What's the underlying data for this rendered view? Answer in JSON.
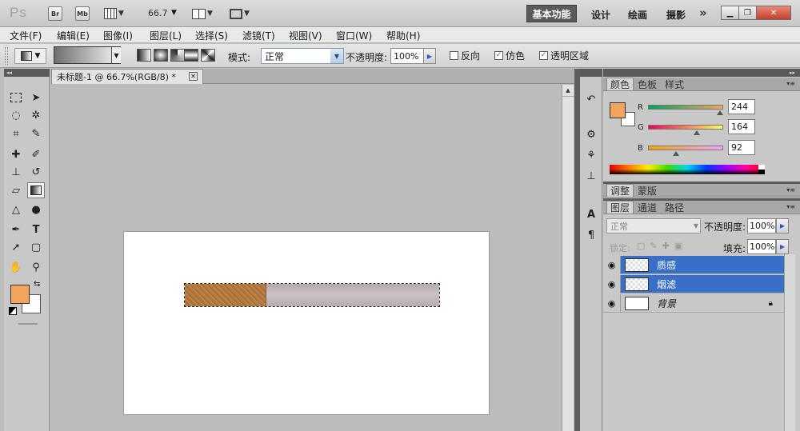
{
  "app": {
    "logo": "Ps"
  },
  "titlebar": {
    "br_label": "Br",
    "mb_label": "Mb",
    "zoom": "66.7",
    "workspaces": {
      "active": "基本功能",
      "design": "设计",
      "painting": "绘画",
      "photography": "摄影"
    },
    "more": "»"
  },
  "menu": {
    "file": "文件(F)",
    "edit": "编辑(E)",
    "image": "图像(I)",
    "layer": "图层(L)",
    "select": "选择(S)",
    "filter": "滤镜(T)",
    "view": "视图(V)",
    "window": "窗口(W)",
    "help": "帮助(H)"
  },
  "options": {
    "mode_label": "模式:",
    "mode_value": "正常",
    "opacity_label": "不透明度:",
    "opacity_value": "100%",
    "reverse_label": "反向",
    "dither_label": "仿色",
    "transparency_label": "透明区域",
    "reverse_checked": false,
    "dither_checked": true,
    "transparency_checked": true
  },
  "document": {
    "tab_title": "未标题-1 @ 66.7%(RGB/8) *"
  },
  "colors": {
    "foreground": "#f4a45c",
    "background": "#ffffff",
    "selected_layer": "#3a6fc8",
    "filter_brown": "#b27a3f"
  },
  "color_panel": {
    "tabs": [
      "颜色",
      "色板",
      "样式"
    ],
    "r_label": "R",
    "g_label": "G",
    "b_label": "B",
    "r_value": "244",
    "g_value": "164",
    "b_value": "92",
    "r": 244,
    "g": 164,
    "b": 92
  },
  "adjust_panel": {
    "tabs": [
      "调整",
      "蒙版"
    ]
  },
  "layers_panel": {
    "tabs": [
      "图层",
      "通道",
      "路径"
    ],
    "blend_mode": "正常",
    "opacity_label": "不透明度:",
    "opacity_value": "100%",
    "lock_label": "锁定:",
    "fill_label": "填充:",
    "fill_value": "100%",
    "layers": [
      {
        "name": "质感",
        "selected": true,
        "thumb": "transparent"
      },
      {
        "name": "烟滤",
        "selected": true,
        "thumb": "transparent"
      },
      {
        "name": "背景",
        "selected": false,
        "thumb": "white",
        "locked": true
      }
    ]
  },
  "icons": {
    "eye": "eye-icon",
    "lock": "lock-icon"
  }
}
